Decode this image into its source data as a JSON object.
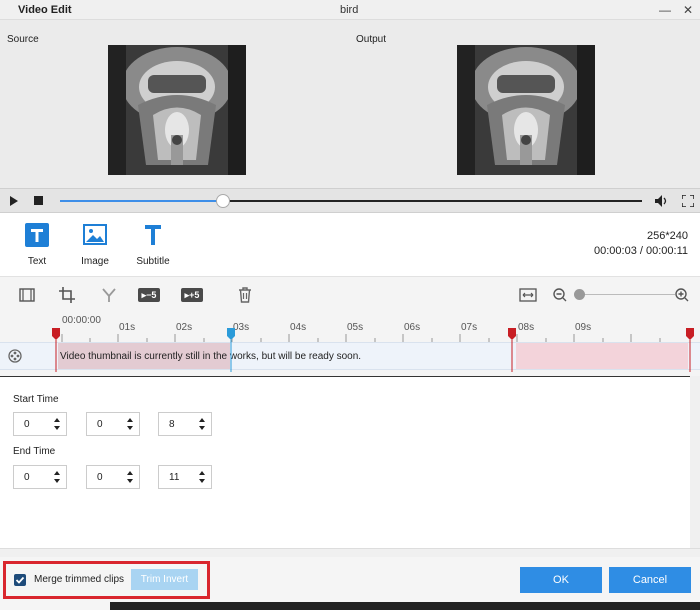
{
  "window": {
    "app_title": "Video Edit",
    "doc_title": "bird",
    "minimize": "—",
    "close": "✕"
  },
  "preview": {
    "source_label": "Source",
    "output_label": "Output"
  },
  "playback": {
    "progress_fraction": 0.28
  },
  "tools": {
    "text_label": "Text",
    "image_label": "Image",
    "subtitle_label": "Subtitle",
    "resolution": "256*240",
    "time_readout": "00:00:03 / 00:00:11"
  },
  "edit_toolbar": {
    "skip_back": "▸−5",
    "skip_forward": "▸+5",
    "zoom_level_fraction": 0.0
  },
  "timeline": {
    "ticks": [
      "00:00:00",
      "01s",
      "02s",
      "03s",
      "04s",
      "05s",
      "06s",
      "07s",
      "08s",
      "09s"
    ],
    "clip_message": "Video thumbnail is currently still in the works, but will be ready soon."
  },
  "trim": {
    "start_label": "Start Time",
    "start_values": [
      "0",
      "0",
      "8"
    ],
    "end_label": "End Time",
    "end_values": [
      "0",
      "0",
      "11"
    ]
  },
  "footer": {
    "merge_label": "Merge trimmed clips",
    "merge_checked": true,
    "trim_invert_label": "Trim Invert",
    "ok_label": "OK",
    "cancel_label": "Cancel",
    "accent_color": "#2f8de4",
    "highlight_color": "#d9262e"
  }
}
